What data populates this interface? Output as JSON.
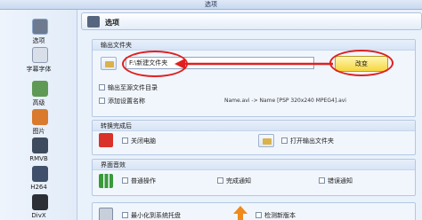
{
  "window": {
    "title": "选项"
  },
  "sidebar": {
    "items": [
      {
        "label": "选项",
        "icon": "options-icon"
      },
      {
        "label": "字幕字体",
        "icon": "subtitle-font-icon"
      },
      {
        "label": "高级",
        "icon": "advanced-icon"
      },
      {
        "label": "图片",
        "icon": "picture-icon"
      },
      {
        "label": "RMVB",
        "icon": "rmvb-icon"
      },
      {
        "label": "H264",
        "icon": "h264-icon"
      },
      {
        "label": "DivX",
        "icon": "divx-icon"
      }
    ]
  },
  "header": {
    "title": "选项"
  },
  "output_folder": {
    "title": "输出文件夹",
    "path": "F:\\新建文件夹",
    "change_label": "改变",
    "save_to_source_label": "输出至源文件目录",
    "add_setting_name_label": "添加设置名称",
    "preview": "Name.avi  ->  Name [PSP 320x240 MPEG4].avi"
  },
  "after_conversion": {
    "title": "转换完成后",
    "shutdown_label": "关闭电脑",
    "open_folder_label": "打开输出文件夹"
  },
  "sound": {
    "title": "界面音效",
    "normal_label": "普通操作",
    "complete_label": "完成通知",
    "error_label": "错误通知"
  },
  "misc": {
    "minimize_tray_label": "最小化到系统托盘",
    "check_version_label": "检测新版本"
  },
  "colors": {
    "accent": "#e02020",
    "button": "#f6d640"
  }
}
